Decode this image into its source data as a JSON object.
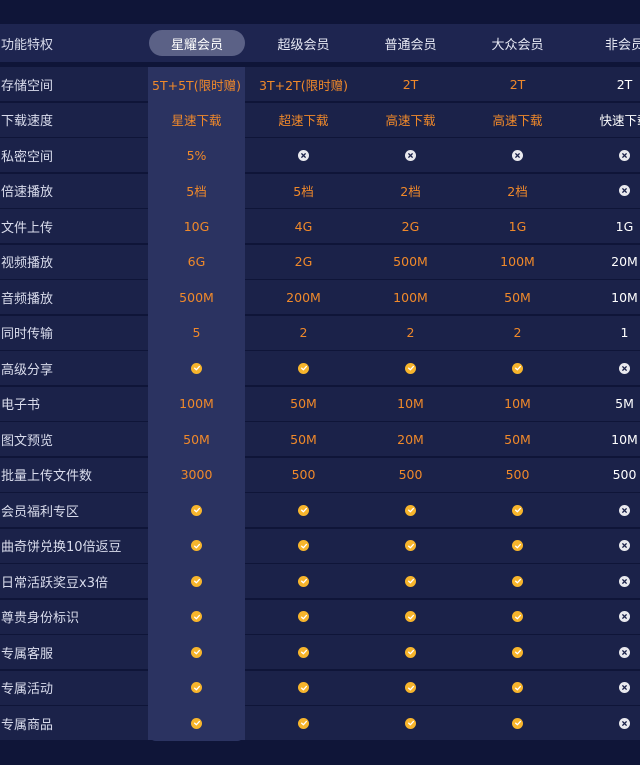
{
  "header": {
    "feature_label": "功能特权",
    "tabs": [
      "星耀会员",
      "超级会员",
      "普通会员",
      "大众会员",
      "非会员"
    ]
  },
  "colors": {
    "background": "#0f1538",
    "row": "#1b2249",
    "highlight": "#2b3361",
    "accent": "#f0892a",
    "check": "#f7b52c"
  },
  "rows": [
    {
      "label": "存储空间",
      "values": [
        "5T+5T(限时赠)",
        "3T+2T(限时赠)",
        "2T",
        "2T",
        "2T"
      ]
    },
    {
      "label": "下载速度",
      "values": [
        "星速下载",
        "超速下载",
        "高速下载",
        "高速下载",
        "快速下载"
      ]
    },
    {
      "label": "私密空间",
      "values": [
        "5%",
        "cross-icon",
        "cross-icon",
        "cross-icon",
        "cross-icon"
      ]
    },
    {
      "label": "倍速播放",
      "values": [
        "5档",
        "5档",
        "2档",
        "2档",
        "cross-icon"
      ]
    },
    {
      "label": "文件上传",
      "values": [
        "10G",
        "4G",
        "2G",
        "1G",
        "1G"
      ]
    },
    {
      "label": "视频播放",
      "values": [
        "6G",
        "2G",
        "500M",
        "100M",
        "20M"
      ]
    },
    {
      "label": "音频播放",
      "values": [
        "500M",
        "200M",
        "100M",
        "50M",
        "10M"
      ]
    },
    {
      "label": "同时传输",
      "values": [
        "5",
        "2",
        "2",
        "2",
        "1"
      ]
    },
    {
      "label": "高级分享",
      "values": [
        "check-icon",
        "check-icon",
        "check-icon",
        "check-icon",
        "cross-icon"
      ]
    },
    {
      "label": "电子书",
      "values": [
        "100M",
        "50M",
        "10M",
        "10M",
        "5M"
      ]
    },
    {
      "label": "图文预览",
      "values": [
        "50M",
        "50M",
        "20M",
        "50M",
        "10M"
      ]
    },
    {
      "label": "批量上传文件数",
      "values": [
        "3000",
        "500",
        "500",
        "500",
        "500"
      ]
    },
    {
      "label": "会员福利专区",
      "values": [
        "check-icon",
        "check-icon",
        "check-icon",
        "check-icon",
        "cross-icon"
      ]
    },
    {
      "label": "曲奇饼兑换10倍返豆",
      "values": [
        "check-icon",
        "check-icon",
        "check-icon",
        "check-icon",
        "cross-icon"
      ]
    },
    {
      "label": "日常活跃奖豆x3倍",
      "values": [
        "check-icon",
        "check-icon",
        "check-icon",
        "check-icon",
        "cross-icon"
      ]
    },
    {
      "label": "尊贵身份标识",
      "values": [
        "check-icon",
        "check-icon",
        "check-icon",
        "check-icon",
        "cross-icon"
      ]
    },
    {
      "label": "专属客服",
      "values": [
        "check-icon",
        "check-icon",
        "check-icon",
        "check-icon",
        "cross-icon"
      ]
    },
    {
      "label": "专属活动",
      "values": [
        "check-icon",
        "check-icon",
        "check-icon",
        "check-icon",
        "cross-icon"
      ]
    },
    {
      "label": "专属商品",
      "values": [
        "check-icon",
        "check-icon",
        "check-icon",
        "check-icon",
        "cross-icon"
      ]
    }
  ]
}
